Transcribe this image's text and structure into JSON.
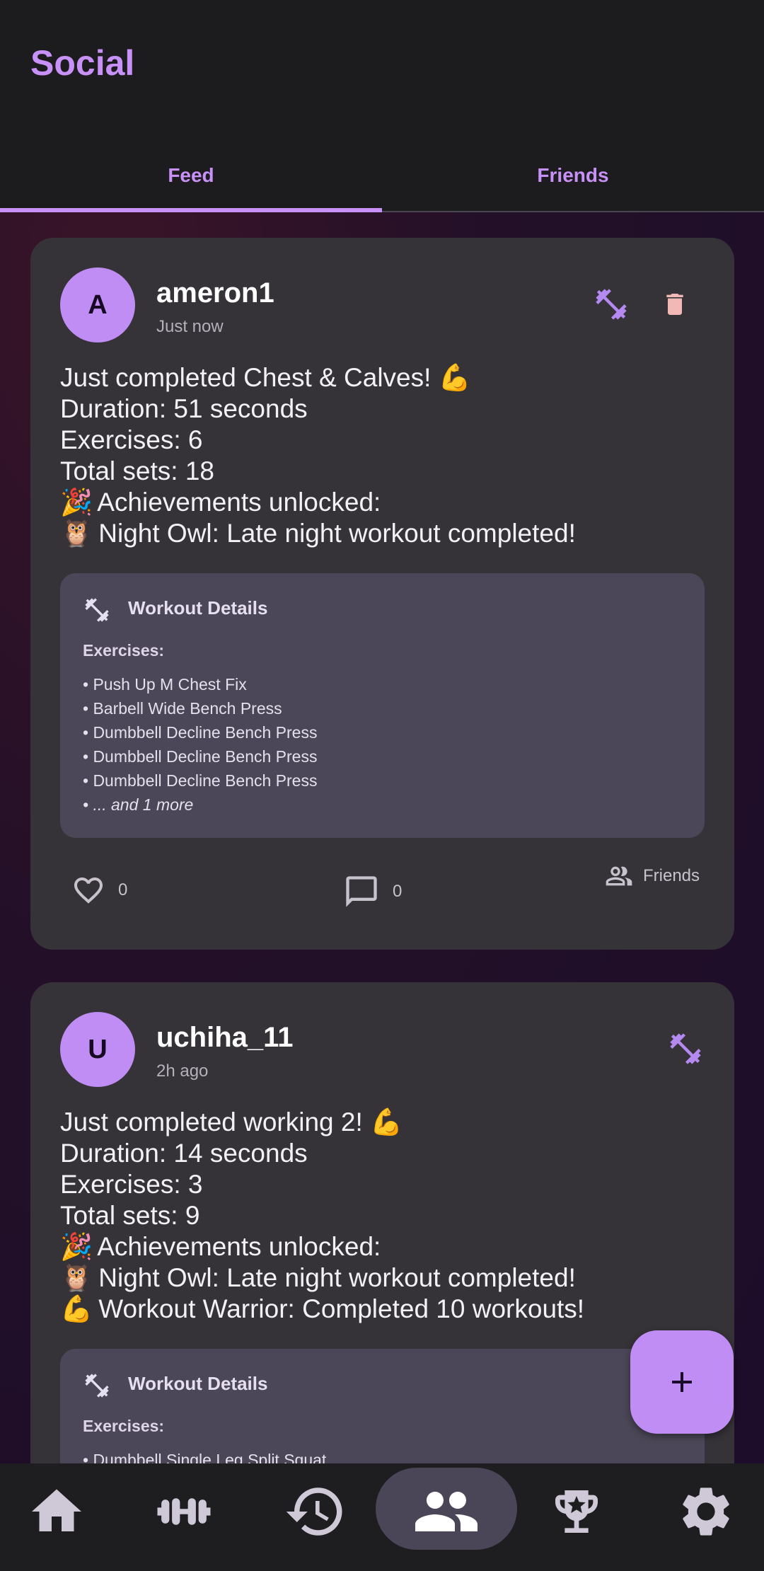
{
  "app": {
    "title": "Social"
  },
  "tabs": [
    {
      "label": "Feed",
      "active": true
    },
    {
      "label": "Friends",
      "active": false
    }
  ],
  "colors": {
    "accent": "#c891f7",
    "card": "#353238",
    "details": "#4b4758",
    "delete": "#f2b8b5"
  },
  "posts": [
    {
      "avatar_letter": "A",
      "username": "ameron1",
      "time": "Just now",
      "lines": [
        {
          "emoji": "",
          "text": "Just completed Chest & Calves! 💪"
        },
        {
          "emoji": "",
          "text": "Duration: 51 seconds"
        },
        {
          "emoji": "",
          "text": "Exercises: 6"
        },
        {
          "emoji": "",
          "text": "Total sets: 18"
        },
        {
          "emoji": "🎉",
          "text": "Achievements unlocked:"
        },
        {
          "emoji": "🦉",
          "text": "Night Owl: Late night workout completed!"
        }
      ],
      "details_title": "Workout Details",
      "exercises_label": "Exercises:",
      "exercises": [
        "• Push Up M Chest Fix",
        "• Barbell Wide Bench Press",
        "• Dumbbell Decline Bench Press",
        "• Dumbbell Decline Bench Press",
        "• Dumbbell Decline Bench Press"
      ],
      "more": "• ... and 1 more",
      "likes": "0",
      "comments": "0",
      "visibility": "Friends"
    },
    {
      "avatar_letter": "U",
      "username": "uchiha_11",
      "time": "2h ago",
      "lines": [
        {
          "emoji": "",
          "text": "Just completed working 2! 💪"
        },
        {
          "emoji": "",
          "text": "Duration: 14 seconds"
        },
        {
          "emoji": "",
          "text": "Exercises: 3"
        },
        {
          "emoji": "",
          "text": "Total sets: 9"
        },
        {
          "emoji": "🎉",
          "text": "Achievements unlocked:"
        },
        {
          "emoji": "🦉",
          "text": "Night Owl: Late night workout completed!"
        },
        {
          "emoji": "💪",
          "text": "Workout Warrior: Completed 10 workouts!"
        }
      ],
      "details_title": "Workout Details",
      "exercises_label": "Exercises:",
      "exercises": [
        "• Dumbbell Single Leg Split Squat"
      ]
    }
  ],
  "nav": [
    {
      "icon": "home-icon",
      "active": false
    },
    {
      "icon": "dumbbell-icon",
      "active": false
    },
    {
      "icon": "history-icon",
      "active": false
    },
    {
      "icon": "people-icon",
      "active": true
    },
    {
      "icon": "trophy-icon",
      "active": false
    },
    {
      "icon": "settings-icon",
      "active": false
    }
  ],
  "fab_icon": "plus-icon"
}
